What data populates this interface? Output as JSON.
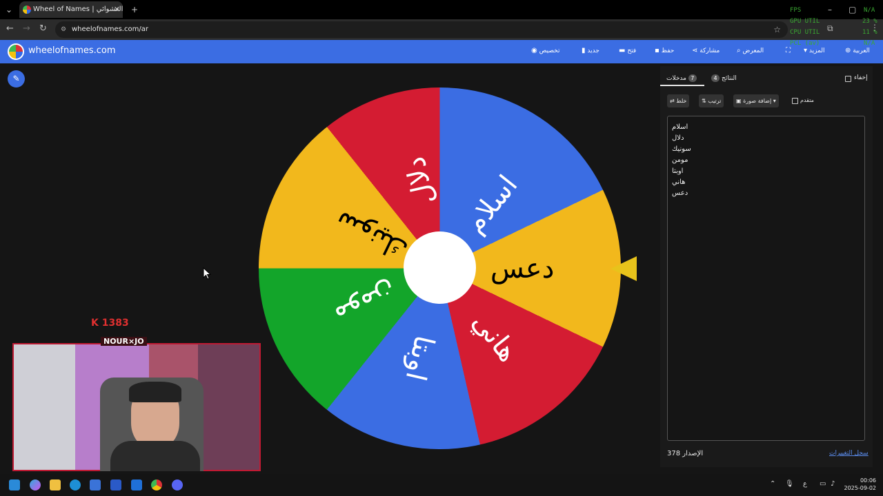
{
  "browser": {
    "tab_title": "Wheel of Names | اسم العشوائي",
    "url": "wheelofnames.com/ar"
  },
  "overlay": {
    "fps_label": "FPS",
    "fps_value": "N/A",
    "gpu_label": "GPU UTIL",
    "gpu_value": "23 %",
    "cpu_label": "CPU UTIL",
    "cpu_value": "11 %",
    "pcl_label": "PCL (av)",
    "pcl_value": "N/A"
  },
  "site": {
    "name": "wheelofnames.com",
    "menu": {
      "customize": "تخصيص",
      "new": "جديد",
      "open": "فتح",
      "save": "حفظ",
      "share": "مشاركة",
      "gallery": "المعرض",
      "more": "المزيد",
      "language": "العربية"
    }
  },
  "wheel": {
    "slices": [
      {
        "label": "دعس",
        "color": "#f2b81c"
      },
      {
        "label": "هاني",
        "color": "#d41c32"
      },
      {
        "label": "اوبتا",
        "color": "#3b6de3"
      },
      {
        "label": "مومن",
        "color": "#13a52a"
      },
      {
        "label": "سونيك",
        "color": "#f2b81c"
      },
      {
        "label": "دلال",
        "color": "#d41c32"
      },
      {
        "label": "اسلام",
        "color": "#3b6de3"
      }
    ]
  },
  "panel": {
    "hide_label": "إخفاء",
    "results_label": "النتائج",
    "results_count": "4",
    "entries_label": "مدخلات",
    "entries_count": "7",
    "shuffle_label": "خلط",
    "sort_label": "ترتيب",
    "add_image_label": "إضافة صورة",
    "advanced_label": "متقدم",
    "entries": [
      "اسلام",
      "دلال",
      "سونيك",
      "مومن",
      "اوبتا",
      "هاني",
      "دعس"
    ],
    "version_label": "الإصدار",
    "version_number": "378",
    "changelog_link": "سجل التغييرات"
  },
  "stream": {
    "kick_count": "1383",
    "streamer_name": "NOUR×JO"
  },
  "taskbar": {
    "time": "00:06",
    "date": "2025-09-02",
    "lang": "ع"
  }
}
